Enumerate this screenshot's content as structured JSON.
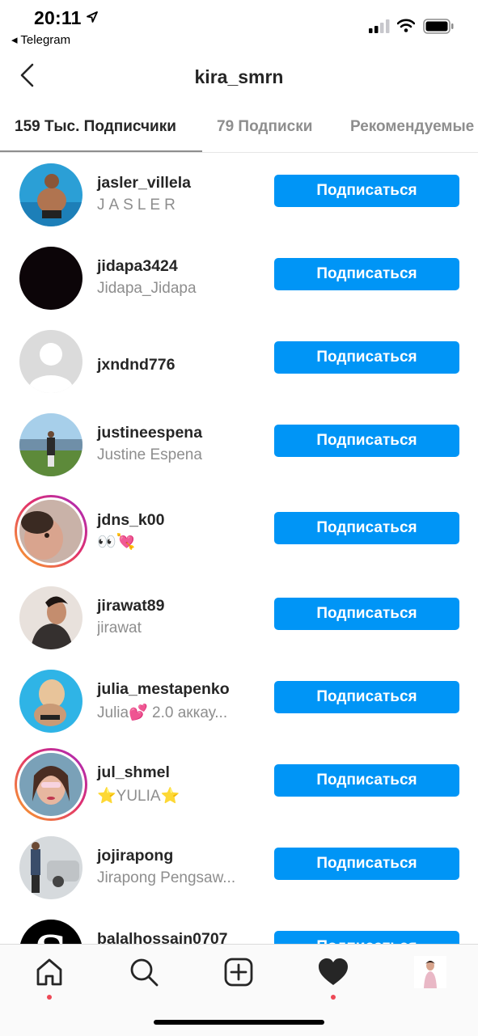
{
  "status_bar": {
    "time": "20:11",
    "back_app": "◂ Telegram"
  },
  "header": {
    "title": "kira_smrn"
  },
  "tabs": [
    {
      "label": "159 Тыс. Подписчики",
      "active": true
    },
    {
      "label": "79 Подписки",
      "active": false
    },
    {
      "label": "Рекомендуемые",
      "active": false
    }
  ],
  "follow_label": "Подписаться",
  "users": [
    {
      "username": "jasler_villela",
      "fullname": "JASLER",
      "story": false
    },
    {
      "username": "jidapa3424",
      "fullname": "Jidapa_Jidapa",
      "story": false
    },
    {
      "username": "jxndnd776",
      "fullname": "",
      "story": false
    },
    {
      "username": "justineespena",
      "fullname": "Justine Espena",
      "story": false
    },
    {
      "username": "jdns_k00",
      "fullname": "👀💘",
      "story": true
    },
    {
      "username": "jirawat89",
      "fullname": "jirawat",
      "story": false
    },
    {
      "username": "julia_mestapenko",
      "fullname": "Julia💕 2.0 аккау...",
      "story": false
    },
    {
      "username": "jul_shmel",
      "fullname": "⭐YULIA⭐",
      "story": true
    },
    {
      "username": "jojirapong",
      "fullname": "Jirapong Pengsaw...",
      "story": false
    },
    {
      "username": "balalhossain0707",
      "fullname": "",
      "story": false
    }
  ],
  "colors": {
    "accent": "#0095f6",
    "notification": "#ed4956"
  },
  "tabbar_icons": [
    "home-icon",
    "search-icon",
    "add-post-icon",
    "activity-heart-icon",
    "profile-avatar"
  ]
}
